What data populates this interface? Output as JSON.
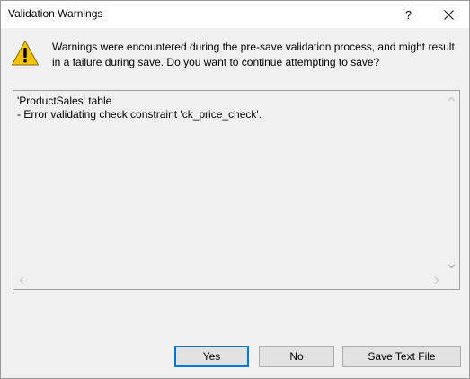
{
  "window": {
    "title": "Validation Warnings",
    "help_glyph": "?",
    "close_icon": "close-icon"
  },
  "message": {
    "icon": "warning-icon",
    "line1": "Warnings were encountered during the pre-save validation process, and might result",
    "line2": "in a failure during save. Do you want to continue attempting to save?"
  },
  "details": {
    "lines": [
      "'ProductSales' table",
      "- Error validating check constraint 'ck_price_check'."
    ]
  },
  "buttons": {
    "yes_label": "Yes",
    "no_label": "No",
    "save_text_file_label": "Save Text File"
  },
  "colors": {
    "warning_yellow": "#f5c400",
    "default_button_border": "#0078d7",
    "dialog_background": "#f0f0f0"
  }
}
